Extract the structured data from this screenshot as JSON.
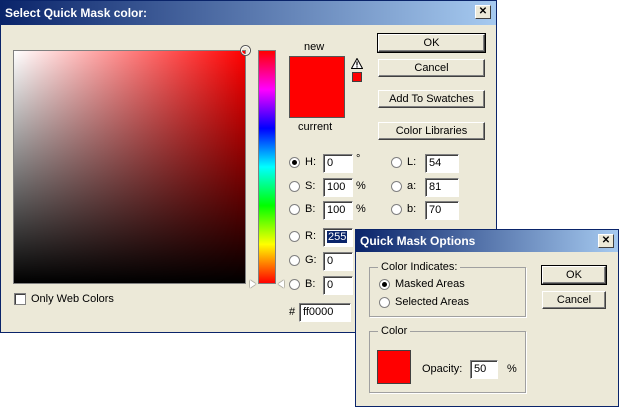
{
  "picker": {
    "title": "Select Quick Mask color:",
    "close_glyph": "✕",
    "label_new": "new",
    "label_current": "current",
    "color_new": "#ff0000",
    "color_current": "#ff0000",
    "gamut_warning_icon": "warning-triangle-icon",
    "buttons": {
      "ok": "OK",
      "cancel": "Cancel",
      "add_to_swatches": "Add To Swatches",
      "color_libraries": "Color Libraries"
    },
    "fields": {
      "H": {
        "label": "H:",
        "value": "0",
        "unit": "°"
      },
      "S": {
        "label": "S:",
        "value": "100",
        "unit": "%"
      },
      "B": {
        "label": "B:",
        "value": "100",
        "unit": "%"
      },
      "R": {
        "label": "R:",
        "value": "255"
      },
      "G": {
        "label": "G:",
        "value": "0"
      },
      "Bl": {
        "label": "B:",
        "value": "0"
      },
      "L": {
        "label": "L:",
        "value": "54"
      },
      "a": {
        "label": "a:",
        "value": "81"
      },
      "b": {
        "label": "b:",
        "value": "70"
      }
    },
    "hex_label": "#",
    "hex_value": "ff0000",
    "only_web_colors": "Only Web Colors"
  },
  "quick_mask": {
    "title": "Quick Mask Options",
    "close_glyph": "✕",
    "color_indicates_legend": "Color Indicates:",
    "option_masked": "Masked Areas",
    "option_selected": "Selected Areas",
    "color_legend": "Color",
    "opacity_label": "Opacity:",
    "opacity_value": "50",
    "opacity_unit": "%",
    "mask_color": "#ff0000",
    "ok": "OK",
    "cancel": "Cancel"
  }
}
